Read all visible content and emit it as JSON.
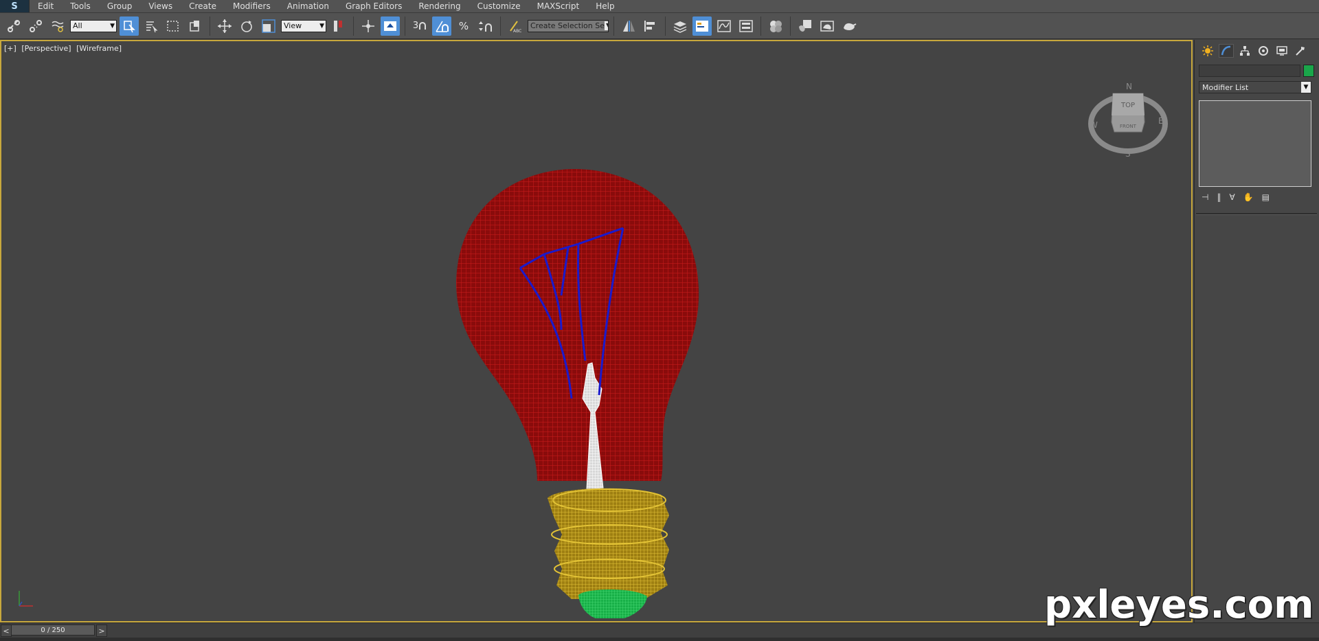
{
  "menubar": {
    "items": [
      "Edit",
      "Tools",
      "Group",
      "Views",
      "Create",
      "Modifiers",
      "Animation",
      "Graph Editors",
      "Rendering",
      "Customize",
      "MAXScript",
      "Help"
    ]
  },
  "toolbar": {
    "selection_filter": "All",
    "reference_coord": "View",
    "snap_label": "3",
    "named_selection_placeholder": "Create Selection Se"
  },
  "viewport": {
    "label_plus": "[+]",
    "label_view": "[Perspective]",
    "label_shading": "[Wireframe]",
    "viewcube": {
      "top": "TOP",
      "front": "FRONT"
    },
    "colors": {
      "bulb": "#a01010",
      "filament": "#1a1acc",
      "stem": "#ffffff",
      "base": "#c8a81e",
      "tip": "#22cc55"
    }
  },
  "command_panel": {
    "modifier_list": "Modifier List",
    "object_color": "#1aa64a"
  },
  "timeline": {
    "frame_display": "0 / 250",
    "prev": "<",
    "next": ">"
  },
  "watermark": "pxleyes.com"
}
